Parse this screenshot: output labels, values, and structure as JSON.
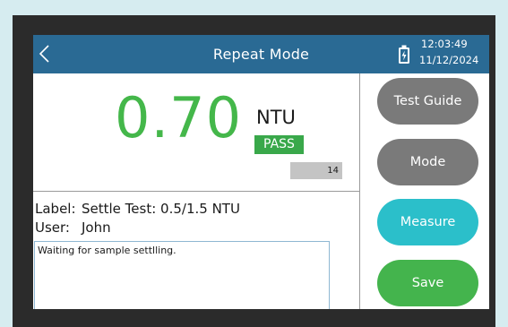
{
  "header": {
    "title": "Repeat Mode",
    "time": "12:03:49",
    "date": "11/12/2024"
  },
  "reading": {
    "value": "0.70",
    "unit": "NTU",
    "status": "PASS",
    "count": "14"
  },
  "info": {
    "label_key": "Label:",
    "label_value": "Settle Test: 0.5/1.5 NTU",
    "user_key": "User:",
    "user_value": "John"
  },
  "notes": {
    "text": "Waiting for sample settlling."
  },
  "buttons": {
    "test_guide": "Test Guide",
    "mode": "Mode",
    "measure": "Measure",
    "save": "Save"
  },
  "colors": {
    "header_bg": "#2a6a94",
    "reading_green": "#44b74a",
    "pass_green": "#39a84a",
    "measure_teal": "#2bbfca",
    "save_green": "#44b44d",
    "neutral_gray": "#7a7a7a"
  },
  "icons": {
    "back": "chevron-left-icon",
    "battery": "battery-charging-icon"
  }
}
